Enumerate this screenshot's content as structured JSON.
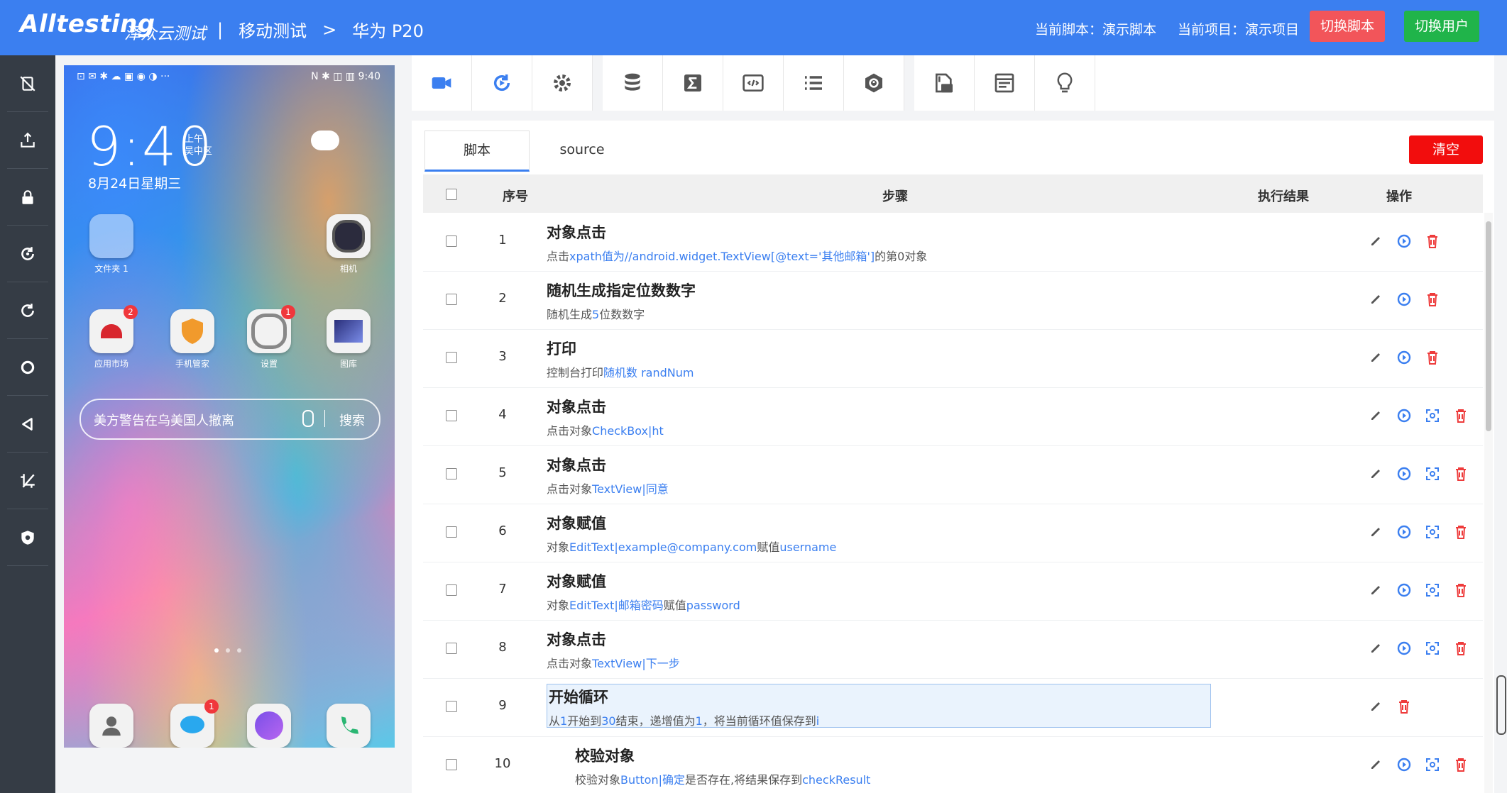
{
  "header": {
    "logo": "Alltesting",
    "logo_cn": "泽众云测试",
    "crumb_sep": "|",
    "crumb_section": "移动测试",
    "crumb_arrow": ">",
    "crumb_device": "华为 P20",
    "current_script": "当前脚本：演示脚本",
    "current_project": "当前项目：演示项目",
    "switch_script": "切换脚本",
    "switch_user": "切换用户"
  },
  "rail": [
    {
      "icon": "screen-off-icon"
    },
    {
      "icon": "install-icon"
    },
    {
      "icon": "lock-icon"
    },
    {
      "icon": "rotate-icon"
    },
    {
      "icon": "refresh-icon"
    },
    {
      "icon": "home-icon"
    },
    {
      "icon": "back-icon"
    },
    {
      "icon": "screenshot-icon"
    },
    {
      "icon": "shield-icon"
    }
  ],
  "phone": {
    "status_left": "⊡ ✉ ✱ ☁ ▣ ◉ ◑ ···",
    "status_right": "N ✱ ◫ ▥ 9:40",
    "clock": "9:40",
    "clock_ampm": "上午",
    "clock_loc": "吴中区",
    "date": "8月24日星期三",
    "apps": [
      {
        "label": "文件夹 1",
        "badge": ""
      },
      {
        "label": "相机",
        "badge": ""
      },
      {
        "label": "应用市场",
        "badge": "2"
      },
      {
        "label": "手机管家",
        "badge": ""
      },
      {
        "label": "设置",
        "badge": "1"
      },
      {
        "label": "图库",
        "badge": ""
      }
    ],
    "dock_badge": "1",
    "search_text": "美方警告在乌美国人撤离",
    "search_btn": "搜索"
  },
  "tabs": {
    "script": "脚本",
    "source": "source",
    "clear": "清空"
  },
  "table": {
    "col_index": "序号",
    "col_steps": "步骤",
    "col_result": "执行结果",
    "col_ops": "操作",
    "rows": [
      {
        "index": "1",
        "title": "对象点击",
        "desc_pre": "点击",
        "desc_hl": "xpath值为//android.widget.TextView[@text='其他邮箱']",
        "desc_post": "的第0对象"
      },
      {
        "index": "2",
        "title": "随机生成指定位数数字",
        "desc_pre": "随机生成",
        "desc_hl": "5",
        "desc_post": "位数数字"
      },
      {
        "index": "3",
        "title": "打印",
        "desc_pre": "控制台打印",
        "desc_hl": "随机数 randNum",
        "desc_post": ""
      },
      {
        "index": "4",
        "title": "对象点击",
        "desc_pre": "点击对象",
        "desc_hl": "CheckBox|ht",
        "desc_post": ""
      },
      {
        "index": "5",
        "title": "对象点击",
        "desc_pre": "点击对象",
        "desc_hl": "TextView|同意",
        "desc_post": ""
      },
      {
        "index": "6",
        "title": "对象赋值",
        "desc_pre": "对象",
        "desc_hl": "EditText|example@company.com",
        "desc_post": "赋值",
        "desc_hl2": "username"
      },
      {
        "index": "7",
        "title": "对象赋值",
        "desc_pre": "对象",
        "desc_hl": "EditText|邮箱密码",
        "desc_post": "赋值",
        "desc_hl2": "password"
      },
      {
        "index": "8",
        "title": "对象点击",
        "desc_pre": "点击对象",
        "desc_hl": "TextView|下一步",
        "desc_post": ""
      },
      {
        "index": "9",
        "title": "开始循环",
        "desc_pre": "从",
        "desc_hl": "1",
        "desc_post": "开始到",
        "desc_hl2": "30",
        "desc_post2": "结束，递增值为",
        "desc_hl3": "1",
        "desc_post3": "，将当前循环值保存到",
        "desc_hl4": "i"
      },
      {
        "index": "10",
        "title": "校验对象",
        "desc_pre": "校验对象",
        "desc_hl": "Button|确定",
        "desc_post": "是否存在,将结果保存到",
        "desc_hl2": "checkResult"
      }
    ]
  },
  "colors": {
    "accent": "#3b7ff0",
    "danger": "#f20d0d",
    "switch_script_bg": "#f2555a",
    "switch_user_bg": "#20b44a",
    "rail_bg": "#353c45"
  }
}
